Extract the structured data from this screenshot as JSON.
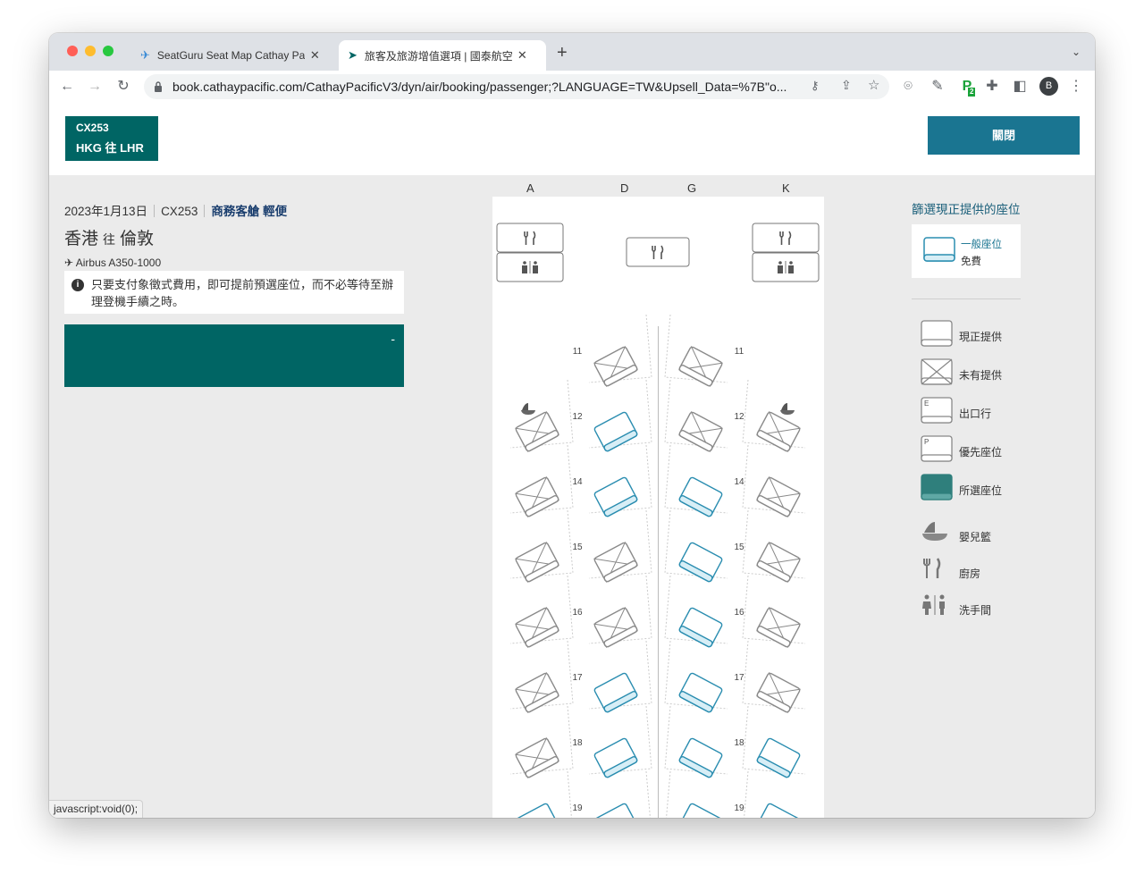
{
  "browser": {
    "tabs": [
      {
        "title": "SeatGuru Seat Map Cathay Pac",
        "active": false
      },
      {
        "title": "旅客及旅游增值選項 | 國泰航空",
        "active": true
      }
    ],
    "url": "book.cathaypacific.com/CathayPacificV3/dyn/air/booking/passenger;?LANGUAGE=TW&Upsell_Data=%7B\"o...",
    "profile_initial": "B",
    "extension_badge": "2",
    "status_text": "javascript:void(0);"
  },
  "header": {
    "flight_code": "CX253",
    "route": "HKG 往 LHR",
    "close_label": "關閉"
  },
  "flight": {
    "date": "2023年1月13日",
    "code": "CX253",
    "cabin": "商務客艙 輕便",
    "origin": "香港",
    "to_word": "往",
    "destination": "倫敦",
    "aircraft": "Airbus A350-1000",
    "notice": "只要支付象徵式費用，即可提前預選座位，而不必等待至辦理登機手續之時。",
    "panel_toggle": "-"
  },
  "seatmap": {
    "columns": [
      "A",
      "D",
      "G",
      "K"
    ],
    "rows": [
      {
        "number": "11",
        "A": "none",
        "D": "unavailable",
        "G": "unavailable",
        "K": "none"
      },
      {
        "number": "12",
        "A": "unavailable",
        "D": "available",
        "G": "unavailable",
        "K": "unavailable"
      },
      {
        "number": "14",
        "A": "unavailable",
        "D": "available",
        "G": "available",
        "K": "unavailable"
      },
      {
        "number": "15",
        "A": "unavailable",
        "D": "unavailable",
        "G": "available",
        "K": "unavailable"
      },
      {
        "number": "16",
        "A": "unavailable",
        "D": "unavailable",
        "G": "available",
        "K": "unavailable"
      },
      {
        "number": "17",
        "A": "unavailable",
        "D": "available",
        "G": "available",
        "K": "unavailable"
      },
      {
        "number": "18",
        "A": "unavailable",
        "D": "available",
        "G": "available",
        "K": "available"
      },
      {
        "number": "19",
        "A": "available",
        "D": "available",
        "G": "available",
        "K": "available"
      }
    ],
    "bassinet_rows": [
      "12"
    ]
  },
  "legend": {
    "title": "篩選現正提供的座位",
    "card_type": "一般座位",
    "card_price": "免費",
    "items": [
      {
        "icon": "seat-available-icon",
        "label": "現正提供"
      },
      {
        "icon": "seat-unavailable-icon",
        "label": "未有提供"
      },
      {
        "icon": "seat-exit-icon",
        "label": "出口行",
        "letter": "E"
      },
      {
        "icon": "seat-preferred-icon",
        "label": "優先座位",
        "letter": "P"
      },
      {
        "icon": "seat-selected-icon",
        "label": "所選座位"
      },
      {
        "icon": "bassinet-icon",
        "label": "嬰兒籃"
      },
      {
        "icon": "galley-icon",
        "label": "廚房"
      },
      {
        "icon": "lavatory-icon",
        "label": "洗手間"
      }
    ]
  },
  "colors": {
    "brand_teal": "#006564",
    "button_blue": "#1a7591",
    "available_seat": "#2a8db0",
    "unavailable_seat": "#777777"
  }
}
